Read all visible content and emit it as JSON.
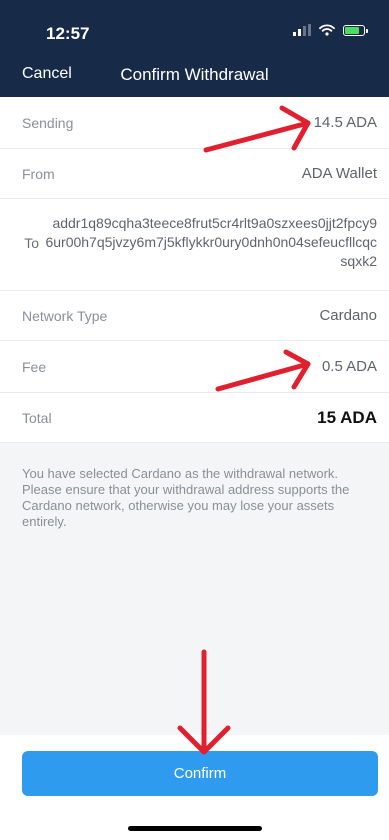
{
  "status_bar": {
    "time": "12:57"
  },
  "nav": {
    "cancel_label": "Cancel",
    "title": "Confirm Withdrawal"
  },
  "details": {
    "sending": {
      "label": "Sending",
      "value": "14.5 ADA"
    },
    "from": {
      "label": "From",
      "value": "ADA Wallet"
    },
    "to": {
      "label": "To",
      "value": "addr1q89cqha3teece8frut5cr4rlt9a0szxees0jjt2fpcy96ur00h7q5jvzy6m7j5kflykkr0ury0dnh0n04sefeucfllcqcsqxk2"
    },
    "network_type": {
      "label": "Network Type",
      "value": "Cardano"
    },
    "fee": {
      "label": "Fee",
      "value": "0.5 ADA"
    },
    "total": {
      "label": "Total",
      "value": "15 ADA"
    }
  },
  "notice": "You have selected Cardano as the withdrawal network. Please ensure that your withdrawal address supports the Cardano network, otherwise you may lose your assets entirely.",
  "confirm_button": {
    "label": "Confirm"
  },
  "colors": {
    "header": "#172a48",
    "accent": "#2f9bef",
    "annotation": "#e0202e"
  },
  "icons": [
    "signal-icon",
    "wifi-icon",
    "battery-charging-icon"
  ],
  "annotations": [
    {
      "name": "arrow-to-sending-amount",
      "points_to": "details.sending.value"
    },
    {
      "name": "arrow-to-fee",
      "points_to": "details.fee.value"
    },
    {
      "name": "arrow-to-confirm-button",
      "points_to": "confirm_button.label"
    }
  ]
}
